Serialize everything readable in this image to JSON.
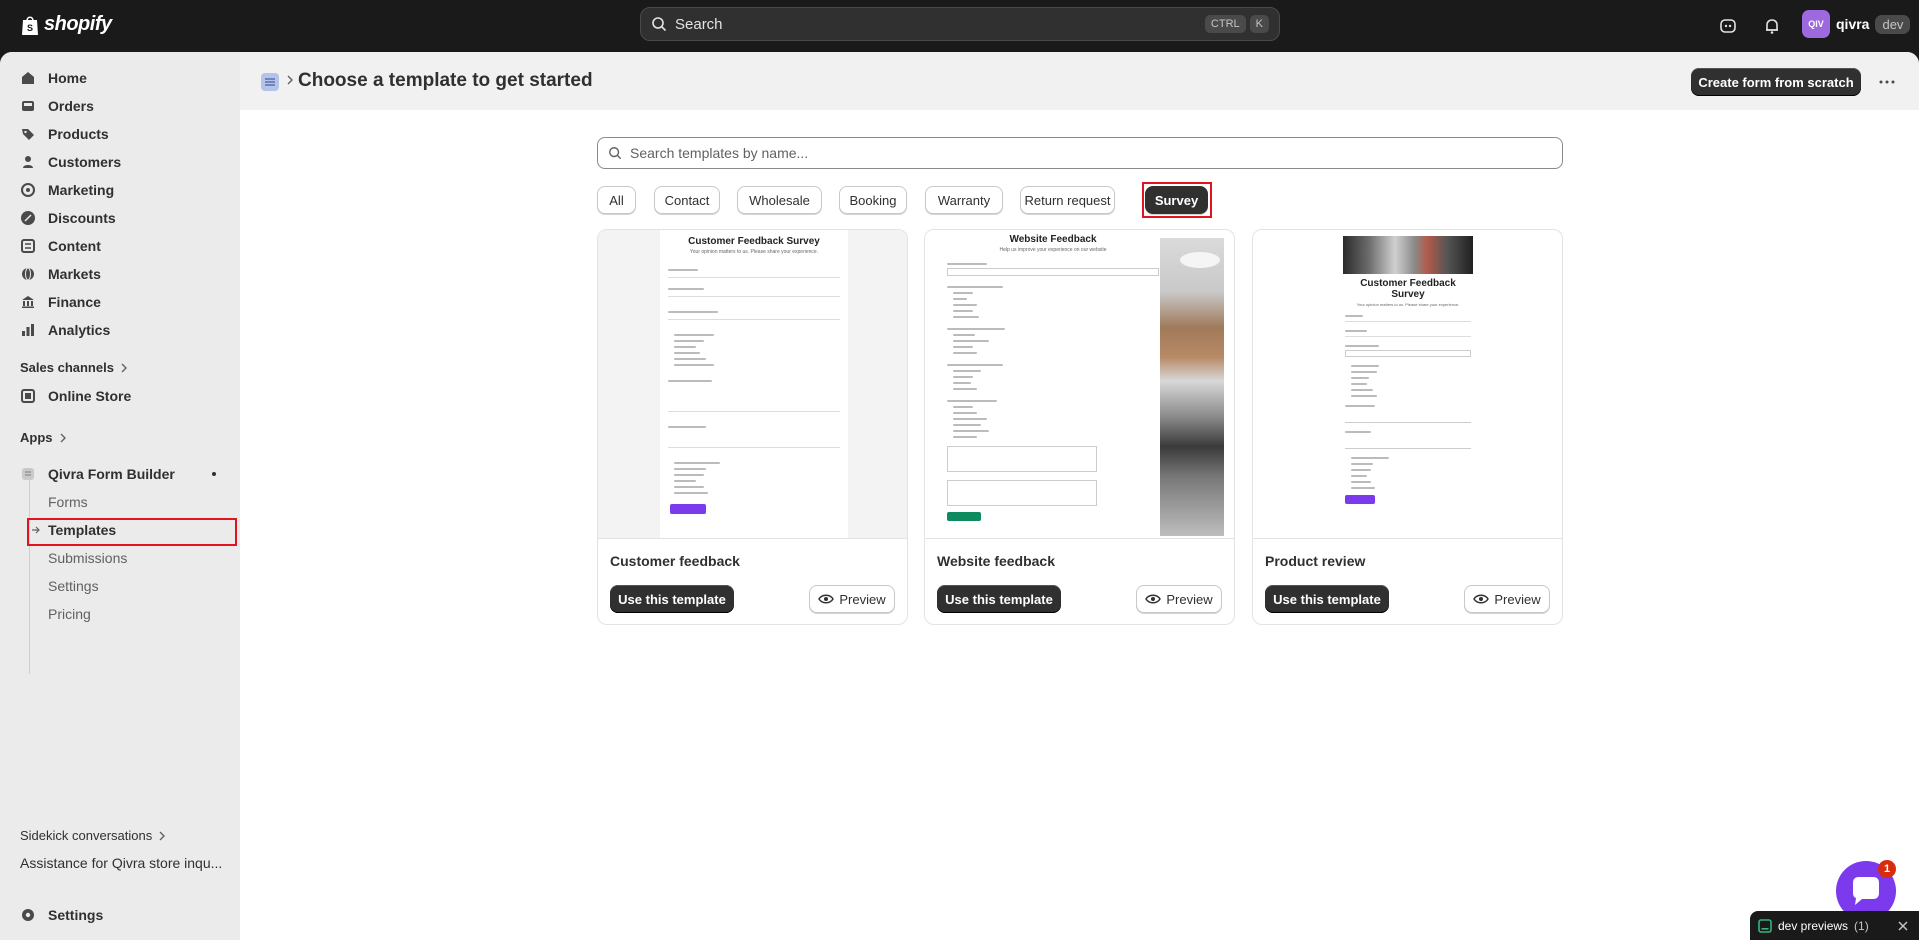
{
  "topbar": {
    "brand": "shopify",
    "search_placeholder": "Search",
    "shortcut_keys": [
      "CTRL",
      "K"
    ],
    "avatar_initials": "QIV",
    "store_name": "qivra",
    "store_tag": "dev"
  },
  "sidebar": {
    "items": [
      {
        "label": "Home",
        "icon": "home-icon"
      },
      {
        "label": "Orders",
        "icon": "inbox-icon"
      },
      {
        "label": "Products",
        "icon": "tag-icon"
      },
      {
        "label": "Customers",
        "icon": "person-icon"
      },
      {
        "label": "Marketing",
        "icon": "target-icon"
      },
      {
        "label": "Discounts",
        "icon": "discount-icon"
      },
      {
        "label": "Content",
        "icon": "content-icon"
      },
      {
        "label": "Markets",
        "icon": "globe-icon"
      },
      {
        "label": "Finance",
        "icon": "bank-icon"
      },
      {
        "label": "Analytics",
        "icon": "chart-icon"
      }
    ],
    "sales_channels_label": "Sales channels",
    "online_store_label": "Online Store",
    "apps_label": "Apps",
    "app_name": "Qivra Form Builder",
    "app_subitems": [
      "Forms",
      "Templates",
      "Submissions",
      "Settings",
      "Pricing"
    ],
    "sidekick_label": "Sidekick conversations",
    "sidekick_item": "Assistance for Qivra store inqu...",
    "settings_label": "Settings"
  },
  "page": {
    "title": "Choose a template to get started",
    "create_button": "Create form from scratch"
  },
  "templates": {
    "search_placeholder": "Search templates by name...",
    "filters": [
      "All",
      "Contact",
      "Wholesale",
      "Booking",
      "Warranty",
      "Return request",
      "Survey"
    ],
    "selected_filter": "Survey",
    "use_label": "Use this template",
    "preview_label": "Preview",
    "cards": [
      {
        "title": "Customer feedback",
        "thumb_heading": "Customer Feedback Survey",
        "thumb_sub": "Your opinion matters to us. Please share your experience."
      },
      {
        "title": "Website feedback",
        "thumb_heading": "Website Feedback",
        "thumb_sub": "Help us improve your experience on our website"
      },
      {
        "title": "Product review",
        "thumb_heading": "Customer Feedback Survey",
        "thumb_sub": "Your opinion matters to us. Please share your experience."
      }
    ]
  },
  "widgets": {
    "chat_badge": "1",
    "dev_label": "dev previews",
    "dev_count": "(1)"
  },
  "colors": {
    "topbar": "#1a1a1a",
    "highlight": "#e0141f",
    "chat": "#7c3aed",
    "submit_purple": "#7c3aed",
    "submit_green": "#0e8a5f"
  }
}
